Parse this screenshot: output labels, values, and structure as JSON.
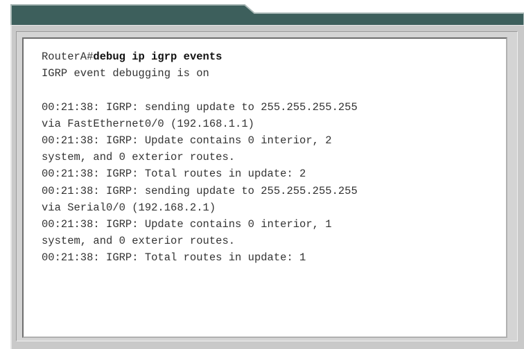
{
  "terminal": {
    "prompt": "RouterA#",
    "command": "debug ip igrp events",
    "lines": [
      "IGRP event debugging is on",
      "",
      "00:21:38: IGRP: sending update to 255.255.255.255",
      "via FastEthernet0/0 (192.168.1.1)",
      "00:21:38: IGRP: Update contains 0 interior, 2",
      "system, and 0 exterior routes.",
      "00:21:38: IGRP: Total routes in update: 2",
      "00:21:38: IGRP: sending update to 255.255.255.255",
      "via Serial0/0 (192.168.2.1)",
      "00:21:38: IGRP: Update contains 0 interior, 1",
      "system, and 0 exterior routes.",
      "00:21:38: IGRP: Total routes in update: 1"
    ]
  },
  "colors": {
    "title_band": "#3d5f5c",
    "title_band_edge": "#a9b8b6",
    "panel": "#c9c9c9",
    "terminal_bg": "#ffffff",
    "text": "#333333"
  }
}
